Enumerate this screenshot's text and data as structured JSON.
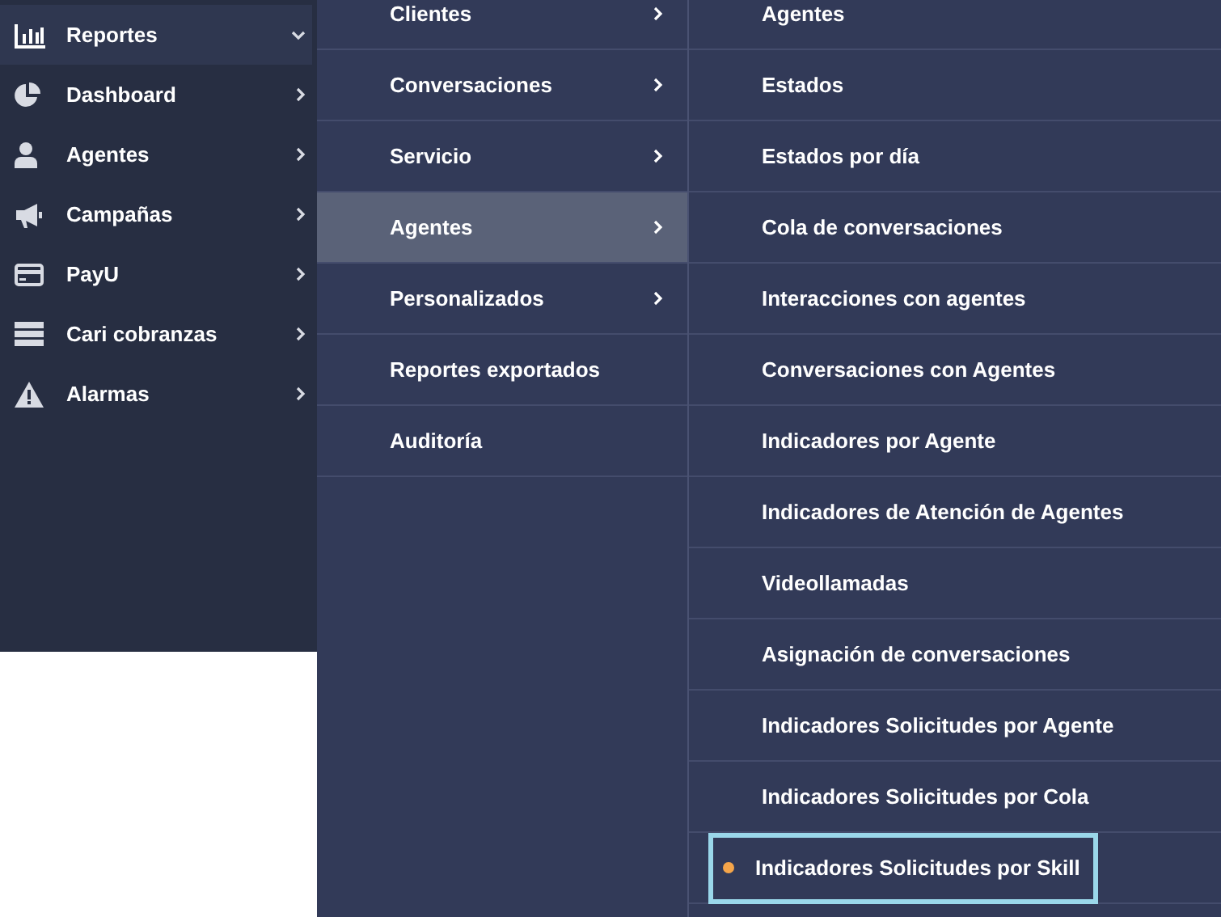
{
  "sidebar": {
    "items": [
      {
        "label": "Reportes",
        "selected": true,
        "expanded": true
      },
      {
        "label": "Dashboard",
        "selected": false,
        "expanded": false
      },
      {
        "label": "Agentes",
        "selected": false,
        "expanded": false
      },
      {
        "label": "Campañas",
        "selected": false,
        "expanded": false
      },
      {
        "label": "PayU",
        "selected": false,
        "expanded": false
      },
      {
        "label": "Cari cobranzas",
        "selected": false,
        "expanded": false
      },
      {
        "label": "Alarmas",
        "selected": false,
        "expanded": false
      }
    ]
  },
  "submenu": {
    "items": [
      {
        "label": "Clientes",
        "has_children": true,
        "selected": false
      },
      {
        "label": "Conversaciones",
        "has_children": true,
        "selected": false
      },
      {
        "label": "Servicio",
        "has_children": true,
        "selected": false
      },
      {
        "label": "Agentes",
        "has_children": true,
        "selected": true
      },
      {
        "label": "Personalizados",
        "has_children": true,
        "selected": false
      },
      {
        "label": "Reportes exportados",
        "has_children": false,
        "selected": false
      },
      {
        "label": "Auditoría",
        "has_children": false,
        "selected": false
      }
    ]
  },
  "reports": {
    "items": [
      {
        "label": "Agentes",
        "selected": false
      },
      {
        "label": "Estados",
        "selected": false
      },
      {
        "label": "Estados por día",
        "selected": false
      },
      {
        "label": "Cola de conversaciones",
        "selected": false
      },
      {
        "label": "Interacciones con agentes",
        "selected": false
      },
      {
        "label": "Conversaciones con Agentes",
        "selected": false
      },
      {
        "label": "Indicadores por Agente",
        "selected": false
      },
      {
        "label": "Indicadores de Atención de Agentes",
        "selected": false
      },
      {
        "label": "Videollamadas",
        "selected": false
      },
      {
        "label": "Asignación de conversaciones",
        "selected": false
      },
      {
        "label": "Indicadores Solicitudes por Agente",
        "selected": false
      },
      {
        "label": "Indicadores Solicitudes por Cola",
        "selected": false
      },
      {
        "label": "Indicadores Solicitudes por Skill",
        "selected": true
      }
    ]
  }
}
